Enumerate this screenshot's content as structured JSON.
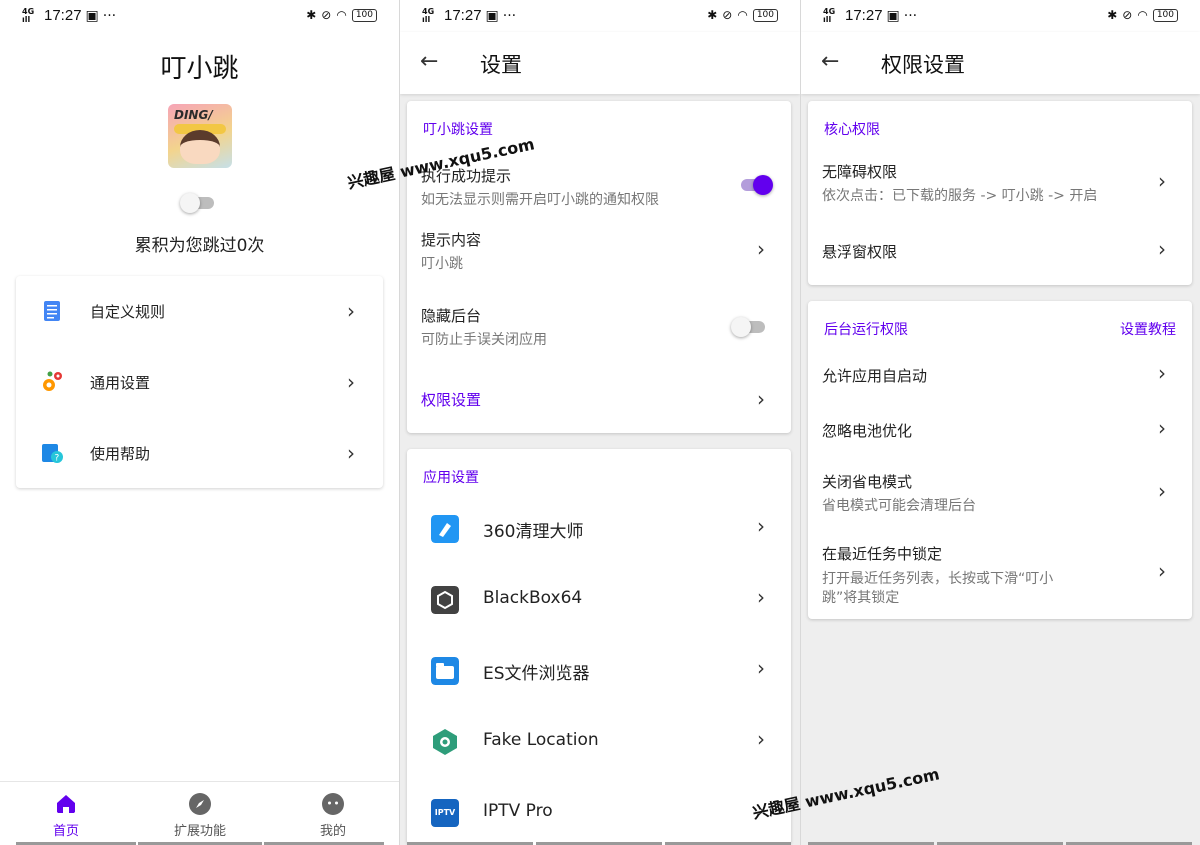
{
  "status_bar": {
    "time": "17:27",
    "network": "4G HD",
    "battery": "100"
  },
  "screen1": {
    "app_title": "叮小跳",
    "count_text": "累积为您跳过0次",
    "menu": [
      {
        "label": "自定义规则",
        "icon": "document-icon"
      },
      {
        "label": "通用设置",
        "icon": "settings-gears-icon"
      },
      {
        "label": "使用帮助",
        "icon": "help-icon"
      }
    ],
    "bottom_nav": [
      {
        "label": "首页",
        "icon": "home-icon",
        "active": true
      },
      {
        "label": "扩展功能",
        "icon": "compass-icon",
        "active": false
      },
      {
        "label": "我的",
        "icon": "profile-icon",
        "active": false
      }
    ]
  },
  "screen2": {
    "title": "设置",
    "section1": {
      "title": "叮小跳设置",
      "items": [
        {
          "title": "执行成功提示",
          "subtitle": "如无法显示则需开启叮小跳的通知权限",
          "toggle": "on"
        },
        {
          "title": "提示内容",
          "subtitle": "叮小跳"
        },
        {
          "title": "隐藏后台",
          "subtitle": "可防止手误关闭应用",
          "toggle": "off"
        },
        {
          "title": "权限设置"
        }
      ]
    },
    "section2": {
      "title": "应用设置",
      "apps": [
        "360清理大师",
        "BlackBox64",
        "ES文件浏览器",
        "Fake Location",
        "IPTV Pro"
      ]
    },
    "iptv_icon_text": "IPTV"
  },
  "screen3": {
    "title": "权限设置",
    "section1": {
      "title": "核心权限",
      "items": [
        {
          "title": "无障碍权限",
          "subtitle": "依次点击：已下载的服务 -> 叮小跳 -> 开启"
        },
        {
          "title": "悬浮窗权限"
        }
      ]
    },
    "section2": {
      "title": "后台运行权限",
      "link": "设置教程",
      "items": [
        {
          "title": "允许应用自启动"
        },
        {
          "title": "忽略电池优化"
        },
        {
          "title": "关闭省电模式",
          "subtitle": "省电模式可能会清理后台"
        },
        {
          "title": "在最近任务中锁定",
          "subtitle_line1": "打开最近任务列表，长按或下滑“叮小",
          "subtitle_line2": "跳”将其锁定"
        }
      ]
    }
  },
  "watermark": "兴趣屋 www.xqu5.com",
  "colors": {
    "accent": "#6200ee",
    "background": "#eeeeee"
  }
}
